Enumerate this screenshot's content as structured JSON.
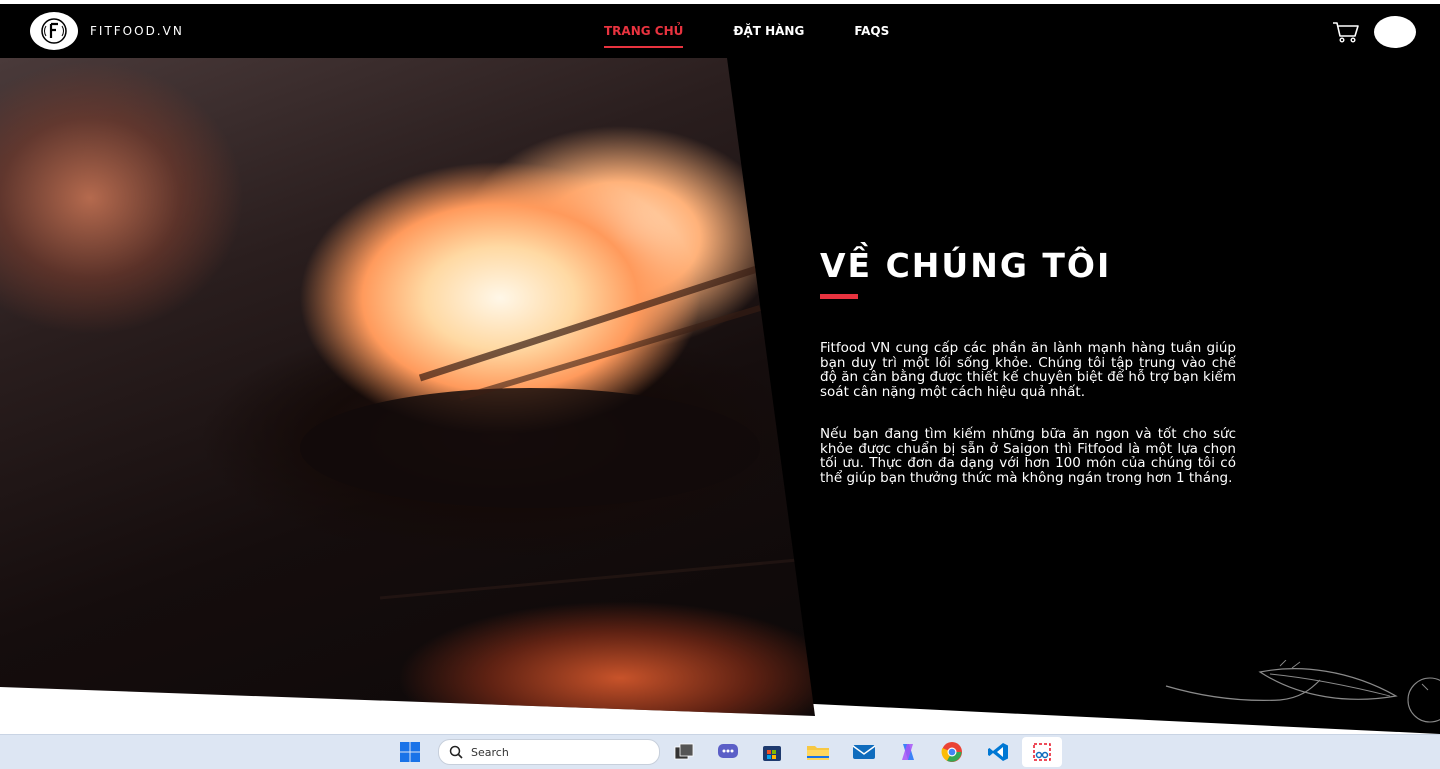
{
  "header": {
    "logo_text": "FITFOOD.VN",
    "nav": [
      {
        "label": "TRANG CHỦ",
        "active": true
      },
      {
        "label": "ĐẶT HÀNG",
        "active": false
      },
      {
        "label": "FAQS",
        "active": false
      }
    ],
    "cart_icon": "cart-icon",
    "avatar_icon": "user-avatar"
  },
  "about": {
    "title": "VỀ CHÚNG TÔI",
    "paragraph1": "Fitfood VN cung cấp các phần ăn lành mạnh hàng tuần giúp bạn duy trì một lối sống khỏe. Chúng tôi tập trung vào chế độ ăn cân bằng được thiết kế chuyên biệt để hỗ trợ bạn kiểm soát cân nặng một cách hiệu quả nhất.",
    "paragraph2": "Nếu bạn đang tìm kiếm những bữa ăn ngon và tốt cho sức khỏe được chuẩn bị sẵn ở Saigon thì Fitfood là một lựa chọn tối ưu. Thực đơn đa dạng với hơn 100 món của chúng tôi có thể giúp bạn thưởng thức mà không ngán trong hơn 1 tháng."
  },
  "colors": {
    "accent": "#e8333f",
    "background": "#000000",
    "taskbar": "#dde6f3"
  },
  "taskbar": {
    "search_placeholder": "Search",
    "apps": [
      "windows-start-icon",
      "task-view-icon",
      "chat-icon",
      "store-icon",
      "file-explorer-icon",
      "mail-icon",
      "copilot-icon",
      "chrome-icon",
      "vscode-icon",
      "snipping-tool-icon"
    ]
  }
}
